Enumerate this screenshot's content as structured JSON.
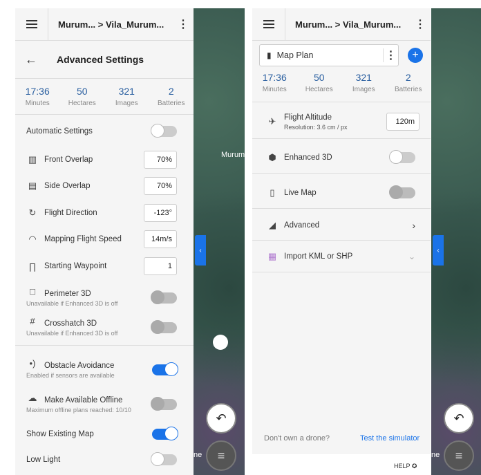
{
  "left": {
    "breadcrumb": "Murum... > Vila_Murum...",
    "title": "Advanced Settings",
    "stats": [
      {
        "v": "17:36",
        "l": "Minutes"
      },
      {
        "v": "50",
        "l": "Hectares"
      },
      {
        "v": "321",
        "l": "Images"
      },
      {
        "v": "2",
        "l": "Batteries"
      }
    ],
    "auto": "Automatic Settings",
    "front": "Front Overlap",
    "front_v": "70%",
    "side": "Side Overlap",
    "side_v": "70%",
    "dir": "Flight Direction",
    "dir_v": "-123°",
    "speed": "Mapping Flight Speed",
    "speed_v": "14m/s",
    "wp": "Starting Waypoint",
    "wp_v": "1",
    "per": "Perimeter 3D",
    "per_s": "Unavailable if Enhanced 3D is off",
    "cross": "Crosshatch 3D",
    "cross_s": "Unavailable if Enhanced 3D is off",
    "obs": "Obstacle Avoidance",
    "obs_s": "Enabled if sensors are available",
    "off": "Make Available Offline",
    "off_s": "Maximum offline plans reached: 10/10",
    "show": "Show Existing Map",
    "low": "Low Light"
  },
  "map_label": "Murum",
  "map_label2": "ne",
  "right": {
    "breadcrumb": "Murum... > Vila_Murum...",
    "plan": "Map Plan",
    "stats": [
      {
        "v": "17:36",
        "l": "Minutes"
      },
      {
        "v": "50",
        "l": "Hectares"
      },
      {
        "v": "321",
        "l": "Images"
      },
      {
        "v": "2",
        "l": "Batteries"
      }
    ],
    "alt": "Flight Altitude",
    "alt_s": "Resolution: 3.6 cm / px",
    "alt_v": "120m",
    "e3d": "Enhanced 3D",
    "live": "Live Map",
    "adv": "Advanced",
    "kml": "Import KML or SHP",
    "nodrone": "Don't own a drone?",
    "sim": "Test the simulator",
    "help": "HELP"
  }
}
